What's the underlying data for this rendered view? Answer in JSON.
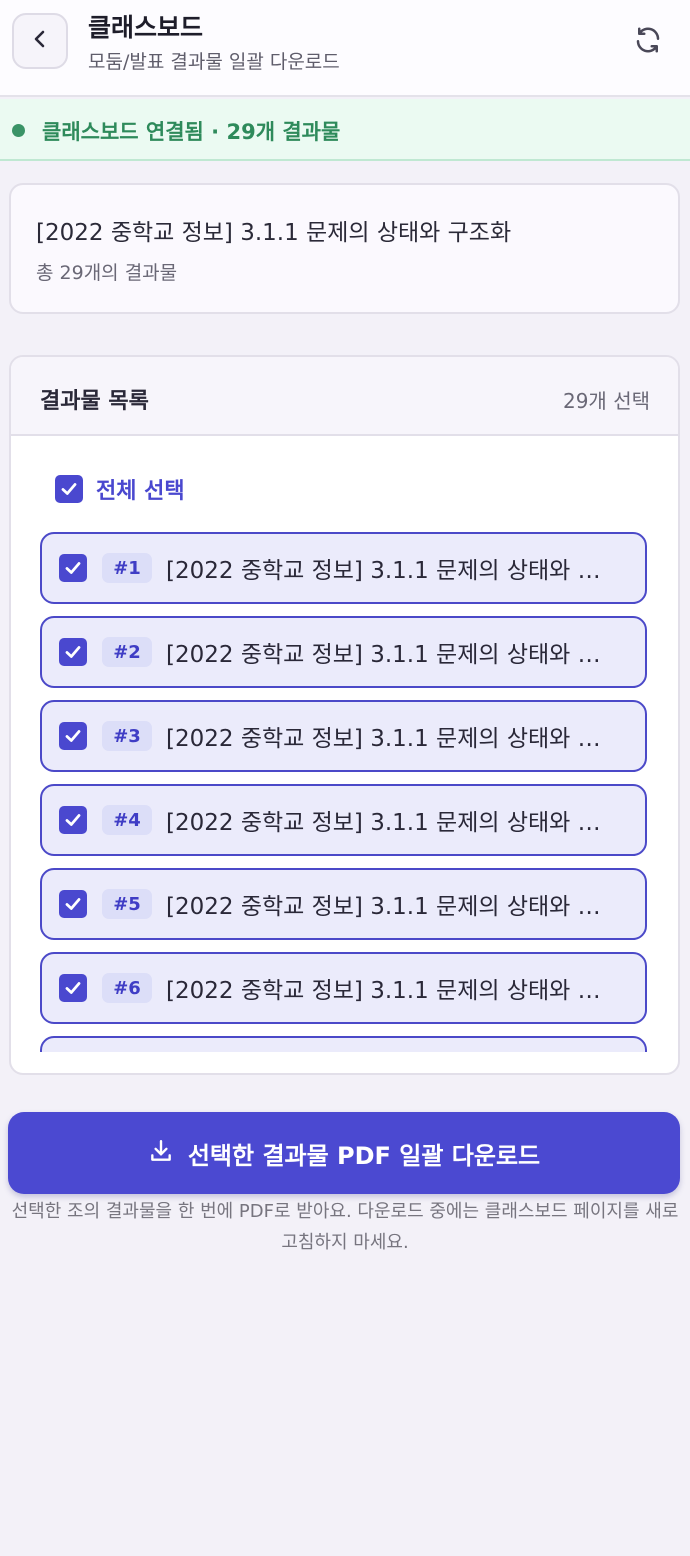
{
  "header": {
    "title": "클래스보드",
    "subtitle": "모둠/발표 결과물 일괄 다운로드"
  },
  "banner": {
    "text": "클래스보드 연결됨 · 29개 결과물"
  },
  "info": {
    "title": "[2022 중학교 정보] 3.1.1 문제의 상태와 구조화",
    "count_text": "총 29개의 결과물"
  },
  "list": {
    "heading": "결과물 목록",
    "selected_count": "29개 선택",
    "select_all_label": "전체 선택",
    "select_all_checked": true,
    "items": [
      {
        "num": "#1",
        "title": "[2022 중학교 정보] 3.1.1 문제의 상태와 구...",
        "checked": true
      },
      {
        "num": "#2",
        "title": "[2022 중학교 정보] 3.1.1 문제의 상태와 구...",
        "checked": true
      },
      {
        "num": "#3",
        "title": "[2022 중학교 정보] 3.1.1 문제의 상태와 구...",
        "checked": true
      },
      {
        "num": "#4",
        "title": "[2022 중학교 정보] 3.1.1 문제의 상태와 구...",
        "checked": true
      },
      {
        "num": "#5",
        "title": "[2022 중학교 정보] 3.1.1 문제의 상태와 구...",
        "checked": true
      },
      {
        "num": "#6",
        "title": "[2022 중학교 정보] 3.1.1 문제의 상태와 구...",
        "checked": true
      },
      {
        "num": "",
        "title": "",
        "checked": true
      }
    ]
  },
  "download": {
    "label": "선택한 결과물 PDF 일괄 다운로드",
    "note": "선택한 조의 결과물을 한 번에 PDF로 받아요. 다운로드 중에는 클래스보드 페이지를 새로고침하지 마세요."
  },
  "colors": {
    "accent": "#4a48cf",
    "success": "#2e8a5b",
    "background": "#f3f1f8"
  }
}
